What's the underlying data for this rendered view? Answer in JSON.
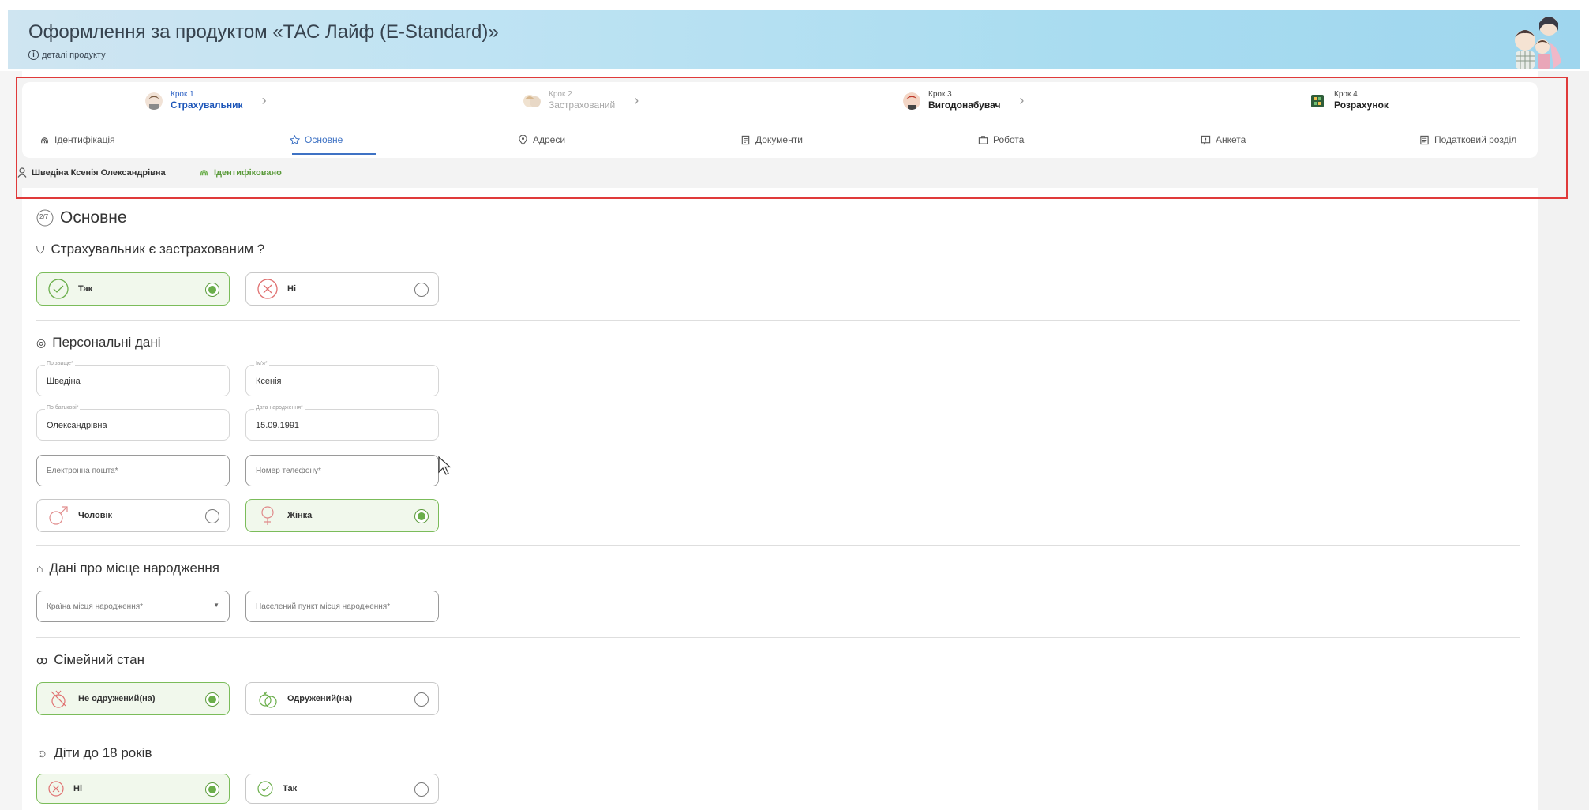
{
  "header": {
    "title": "Оформлення за продуктом «ТАС Лайф (E-Standard)»",
    "details_link": "деталі продукту"
  },
  "stepper": {
    "steps": [
      {
        "num": "Крок 1",
        "name": "Страхувальник"
      },
      {
        "num": "Крок 2",
        "name": "Застрахований"
      },
      {
        "num": "Крок 3",
        "name": "Вигодонабувач"
      },
      {
        "num": "Крок 4",
        "name": "Розрахунок"
      }
    ]
  },
  "tabs": [
    {
      "label": "Ідентифікація",
      "icon": "fingerprint-icon"
    },
    {
      "label": "Основне",
      "icon": "star-icon",
      "active": true
    },
    {
      "label": "Адреси",
      "icon": "location-pin-icon"
    },
    {
      "label": "Документи",
      "icon": "document-icon"
    },
    {
      "label": "Робота",
      "icon": "briefcase-icon"
    },
    {
      "label": "Анкета",
      "icon": "questionnaire-icon"
    },
    {
      "label": "Податковий розділ",
      "icon": "tax-icon"
    }
  ],
  "person": {
    "name": "Шведіна Ксенія Олександрівна",
    "status": "Ідентифіковано"
  },
  "section": {
    "step_counter": "2/7",
    "title": "Основне"
  },
  "insured_question": {
    "title": "Страхувальник є застрахованим ?",
    "options": [
      {
        "label": "Так",
        "selected": true
      },
      {
        "label": "Ні",
        "selected": false
      }
    ]
  },
  "personal": {
    "title": "Персональні дані",
    "surname_label": "Прізвище*",
    "surname": "Шведіна",
    "first_name_label": "Ім'я*",
    "first_name": "Ксенія",
    "patronymic_label": "По батькові*",
    "patronymic": "Олександрівна",
    "birth_label": "Дата народження*",
    "birth": "15.09.1991",
    "email_placeholder": "Електронна пошта*",
    "phone_placeholder": "Номер телефону*",
    "gender_options": [
      {
        "label": "Чоловік",
        "selected": false
      },
      {
        "label": "Жінка",
        "selected": true
      }
    ]
  },
  "birthplace": {
    "title": "Дані про місце народження",
    "country_placeholder": "Країна місця народження*",
    "city_placeholder": "Населений пункт місця народження*"
  },
  "marital": {
    "title": "Сімейний стан",
    "options": [
      {
        "label": "Не одружений(на)",
        "selected": true
      },
      {
        "label": "Одружений(на)",
        "selected": false
      }
    ]
  },
  "children": {
    "title": "Діти до 18 років",
    "options": [
      {
        "label": "Ні",
        "selected": true
      },
      {
        "label": "Так",
        "selected": false
      }
    ]
  },
  "colors": {
    "accent_blue": "#3e72c4",
    "selected_green": "#6aae4a",
    "highlight_red": "#e03a3a"
  }
}
